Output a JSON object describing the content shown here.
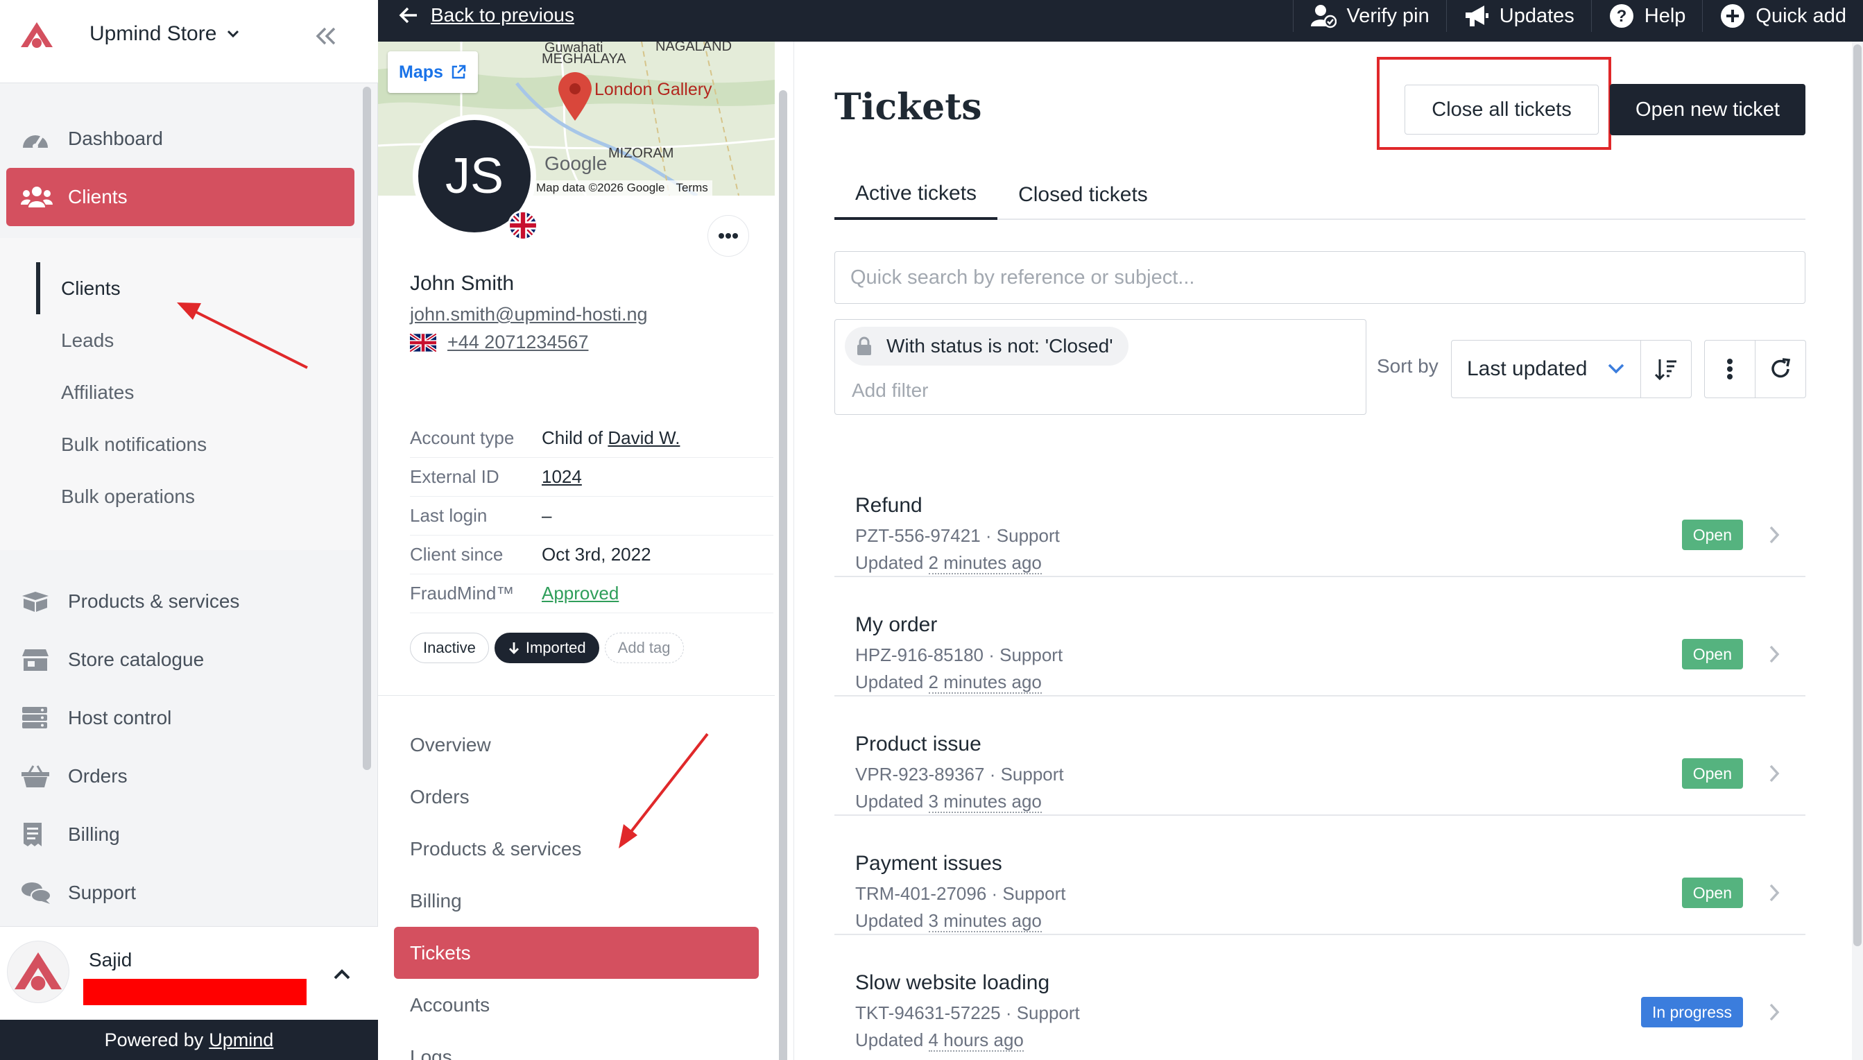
{
  "colors": {
    "accent": "#d4505f",
    "dark": "#1d2430",
    "open_badge": "#55b37f",
    "progress_badge": "#3b7ddd",
    "annotation": "#e0282a"
  },
  "sidebar": {
    "store_name": "Upmind Store",
    "logo_icon": "upmind-logo-icon",
    "collapse_icon": "double-chevron-left-icon",
    "top_items": [
      {
        "label": "Dashboard",
        "icon": "dashboard-gauge-icon",
        "active": false
      },
      {
        "label": "Clients",
        "icon": "users-icon",
        "active": true
      }
    ],
    "sub_items": [
      {
        "label": "Clients",
        "active": true
      },
      {
        "label": "Leads",
        "active": false
      },
      {
        "label": "Affiliates",
        "active": false
      },
      {
        "label": "Bulk notifications",
        "active": false
      },
      {
        "label": "Bulk operations",
        "active": false
      }
    ],
    "bottom_items": [
      {
        "label": "Products & services",
        "icon": "box-icon"
      },
      {
        "label": "Store catalogue",
        "icon": "store-icon"
      },
      {
        "label": "Host control",
        "icon": "server-icon"
      },
      {
        "label": "Orders",
        "icon": "basket-icon"
      },
      {
        "label": "Billing",
        "icon": "receipt-icon"
      },
      {
        "label": "Support",
        "icon": "chat-bubbles-icon"
      }
    ],
    "user": {
      "name": "Sajid"
    },
    "powered_prefix": "Powered by",
    "powered_link": "Upmind"
  },
  "topbar": {
    "back_label": "Back to previous",
    "actions": [
      {
        "label": "Verify pin",
        "icon": "user-check-icon"
      },
      {
        "label": "Updates",
        "icon": "megaphone-icon"
      },
      {
        "label": "Help",
        "icon": "question-circle-icon"
      },
      {
        "label": "Quick add",
        "icon": "plus-circle-icon"
      }
    ]
  },
  "client": {
    "map": {
      "maps_label": "Maps",
      "gallery_label": "London Gallery",
      "attribution": "Map data ©2026 Google",
      "terms": "Terms",
      "google": "Google",
      "regions": [
        "MEGHALAYA",
        "NAGALAND",
        "MIZORAM",
        "Guwahati"
      ]
    },
    "initials": "JS",
    "name": "John Smith",
    "email": "john.smith@upmind-hosti.ng",
    "phone": "+44 2071234567",
    "details": [
      {
        "key": "Account type",
        "prefix": "Child of ",
        "value": "David W.",
        "style": "link"
      },
      {
        "key": "External ID",
        "prefix": "",
        "value": "1024",
        "style": "link"
      },
      {
        "key": "Last login",
        "prefix": "",
        "value": "–",
        "style": "plain"
      },
      {
        "key": "Client since",
        "prefix": "",
        "value": "Oct 3rd, 2022",
        "style": "plain"
      },
      {
        "key": "FraudMind™",
        "prefix": "",
        "value": "Approved",
        "style": "approved"
      }
    ],
    "tags": {
      "inactive": "Inactive",
      "imported": "Imported",
      "add": "Add tag"
    },
    "nav": [
      {
        "label": "Overview",
        "active": false
      },
      {
        "label": "Orders",
        "active": false
      },
      {
        "label": "Products & services",
        "active": false
      },
      {
        "label": "Billing",
        "active": false
      },
      {
        "label": "Tickets",
        "active": true
      },
      {
        "label": "Accounts",
        "active": false
      },
      {
        "label": "Logs",
        "active": false
      }
    ]
  },
  "main": {
    "title": "Tickets",
    "close_all_label": "Close all tickets",
    "open_new_label": "Open new ticket",
    "tabs": [
      {
        "label": "Active tickets",
        "active": true
      },
      {
        "label": "Closed tickets",
        "active": false
      }
    ],
    "search_placeholder": "Quick search by reference or subject...",
    "filter_chip": "With status is not: 'Closed'",
    "add_filter": "Add filter",
    "sort_label": "Sort by",
    "sort_value": "Last updated",
    "tickets": [
      {
        "subject": "Refund",
        "ref": "PZT-556-97421",
        "dept": "Support",
        "updated_prefix": "Updated",
        "updated": "2 minutes ago",
        "status": "Open"
      },
      {
        "subject": "My order",
        "ref": "HPZ-916-85180",
        "dept": "Support",
        "updated_prefix": "Updated",
        "updated": "2 minutes ago",
        "status": "Open"
      },
      {
        "subject": "Product issue",
        "ref": "VPR-923-89367",
        "dept": "Support",
        "updated_prefix": "Updated",
        "updated": "3 minutes ago",
        "status": "Open"
      },
      {
        "subject": "Payment issues",
        "ref": "TRM-401-27096",
        "dept": "Support",
        "updated_prefix": "Updated",
        "updated": "3 minutes ago",
        "status": "Open"
      },
      {
        "subject": "Slow website loading",
        "ref": "TKT-94631-57225",
        "dept": "Support",
        "updated_prefix": "Updated",
        "updated": "4 hours ago",
        "status": "In progress"
      }
    ]
  }
}
